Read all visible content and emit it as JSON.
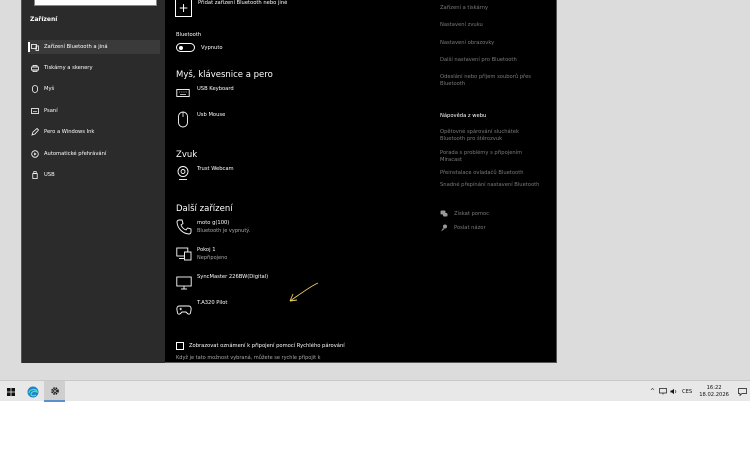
{
  "search": {
    "placeholder": ""
  },
  "sidebar": {
    "heading": "Zařízení",
    "items": [
      {
        "label": "Zařízení Bluetooth a jiná",
        "icon": "bluetooth-devices-icon"
      },
      {
        "label": "Tiskárny a skenery",
        "icon": "printer-icon"
      },
      {
        "label": "Myš",
        "icon": "mouse-icon"
      },
      {
        "label": "Psaní",
        "icon": "keyboard-icon"
      },
      {
        "label": "Pero a Windows Ink",
        "icon": "pen-icon"
      },
      {
        "label": "Automatické přehrávání",
        "icon": "autoplay-icon"
      },
      {
        "label": "USB",
        "icon": "usb-icon"
      }
    ]
  },
  "main": {
    "add_device_label": "Přidat zařízení Bluetooth nebo jiné",
    "bluetooth_label": "Bluetooth",
    "bluetooth_state": "Vypnuto",
    "sections": {
      "input": "Myš, klávesnice a pero",
      "audio": "Zvuk",
      "other": "Další zařízení"
    },
    "input_devices": [
      {
        "name": "USB Keyboard",
        "icon": "keyboard-icon"
      },
      {
        "name": "Usb Mouse",
        "icon": "mouse-icon"
      }
    ],
    "audio_devices": [
      {
        "name": "Trust Webcam",
        "icon": "webcam-icon"
      }
    ],
    "other_devices": [
      {
        "name": "moto g(100)",
        "status": "Bluetooth je vypnutý.",
        "icon": "phone-icon"
      },
      {
        "name": "Pokoj 1",
        "status": "Nepřipojeno",
        "icon": "media-device-icon"
      },
      {
        "name": "SyncMaster 226BW(Digital)",
        "status": "",
        "icon": "monitor-icon"
      },
      {
        "name": "T.A320 Pilot",
        "status": "",
        "icon": "gamepad-icon"
      }
    ],
    "swift_pair_label": "Zobrazovat oznámení k připojení pomocí Rychlého párování",
    "swift_pair_desc": "Když je tato možnost vybraná, můžete se rychle připojit k"
  },
  "related": {
    "links": [
      "Zařízení a tiskárny",
      "Nastavení zvuku",
      "Nastavení obrazovky",
      "Další nastavení pro Bluetooth",
      "Odeslání nebo příjem souborů přes Bluetooth"
    ],
    "help_heading": "Nápověda z webu",
    "help_links": [
      "Opětovné spárování sluchátek Bluetooth pro štěrozvuk",
      "Porada s problémy s připojením Miracast",
      "Přeinstalace ovladačů Bluetooth",
      "Snadné přepínání nastavení Bluetooth"
    ],
    "get_help": "Získat pomoc",
    "feedback": "Poslat názor"
  },
  "taskbar": {
    "language": "CES",
    "time": "16:22",
    "date": "18.02.2026"
  },
  "colors": {
    "accent_arrow": "#f0d060",
    "window_bg": "#000000",
    "sidebar_bg": "#2b2b2b"
  }
}
